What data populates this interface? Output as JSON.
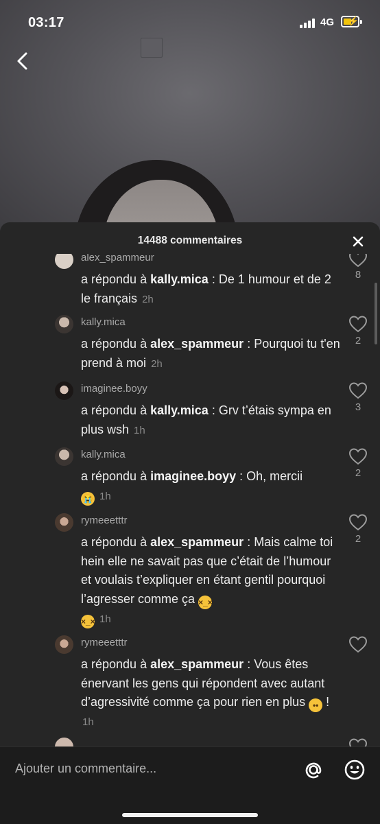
{
  "status": {
    "time": "03:17",
    "network": "4G",
    "battery_pct": 60
  },
  "sheet": {
    "title": "14488 commentaires"
  },
  "comments": [
    {
      "username": "alex_spammeur",
      "prefix": "a répondu à ",
      "mention": "kally.mica",
      "text": " : De 1 humour et de 2 le français",
      "time": "2h",
      "likes": "8"
    },
    {
      "username": "kally.mica",
      "prefix": "a répondu à ",
      "mention": "alex_spammeur",
      "text": " : Pourquoi tu t'en prend à moi",
      "time": "2h",
      "likes": "2"
    },
    {
      "username": "imaginee.boyy",
      "prefix": "a répondu à ",
      "mention": "kally.mica",
      "text": " : Grv t’étais sympa en plus wsh",
      "time": "1h",
      "likes": "3"
    },
    {
      "username": "kally.mica",
      "prefix": "a répondu à ",
      "mention": "imaginee.boyy",
      "text": " : Oh, mercii",
      "time": "1h",
      "likes": "2"
    },
    {
      "username": "rymeeetttr",
      "prefix": "a répondu à ",
      "mention": "alex_spammeur",
      "text": " : Mais calme toi hein elle ne savait pas que c’était de l’humour et voulais t’expliquer en étant gentil pourquoi l’agresser comme ça",
      "time": "1h",
      "likes": "2"
    },
    {
      "username": "rymeeetttr",
      "prefix": "a répondu à ",
      "mention": "alex_spammeur",
      "text": " : Vous êtes énervant les gens qui répondent avec autant d’agressivité comme ça pour rien en plus",
      "text_tail": " !",
      "time": "1h",
      "likes": ""
    }
  ],
  "input": {
    "placeholder": "Ajouter un commentaire..."
  },
  "icons": {
    "back": "chevron-left-icon",
    "close": "close-icon",
    "like": "heart-outline-icon",
    "mention": "at-icon",
    "emoji": "smile-icon"
  },
  "colors": {
    "sheet_bg": "#262626",
    "input_bg": "#1c1c1c",
    "battery": "#f2c40d"
  }
}
